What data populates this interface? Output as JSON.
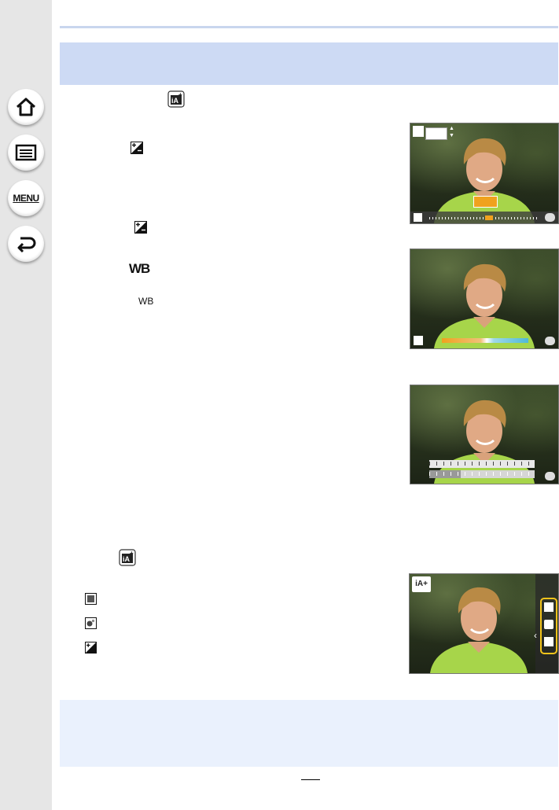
{
  "nav": {
    "home": "home-icon",
    "contents": "contents-list-icon",
    "menu_label": "MENU",
    "back": "back-icon"
  },
  "page": {
    "page_number": ""
  },
  "icons": {
    "intelligent_auto_plus": "iA+",
    "exposure_comp": "exposure-compensation-icon",
    "white_balance": "WB",
    "white_balance_small": "WB",
    "defocus": "defocus-icon",
    "brightness": "brightness-icon"
  },
  "figures": {
    "fig1_value_box": "",
    "fig4_mode_badge": "iA+"
  },
  "colors": {
    "header_band": "#cddaf4",
    "note_band": "#eaf1fd",
    "sidebar": "#e6e6e6",
    "accent_orange": "#f0a21e",
    "accent_yellow": "#f3c41b"
  }
}
